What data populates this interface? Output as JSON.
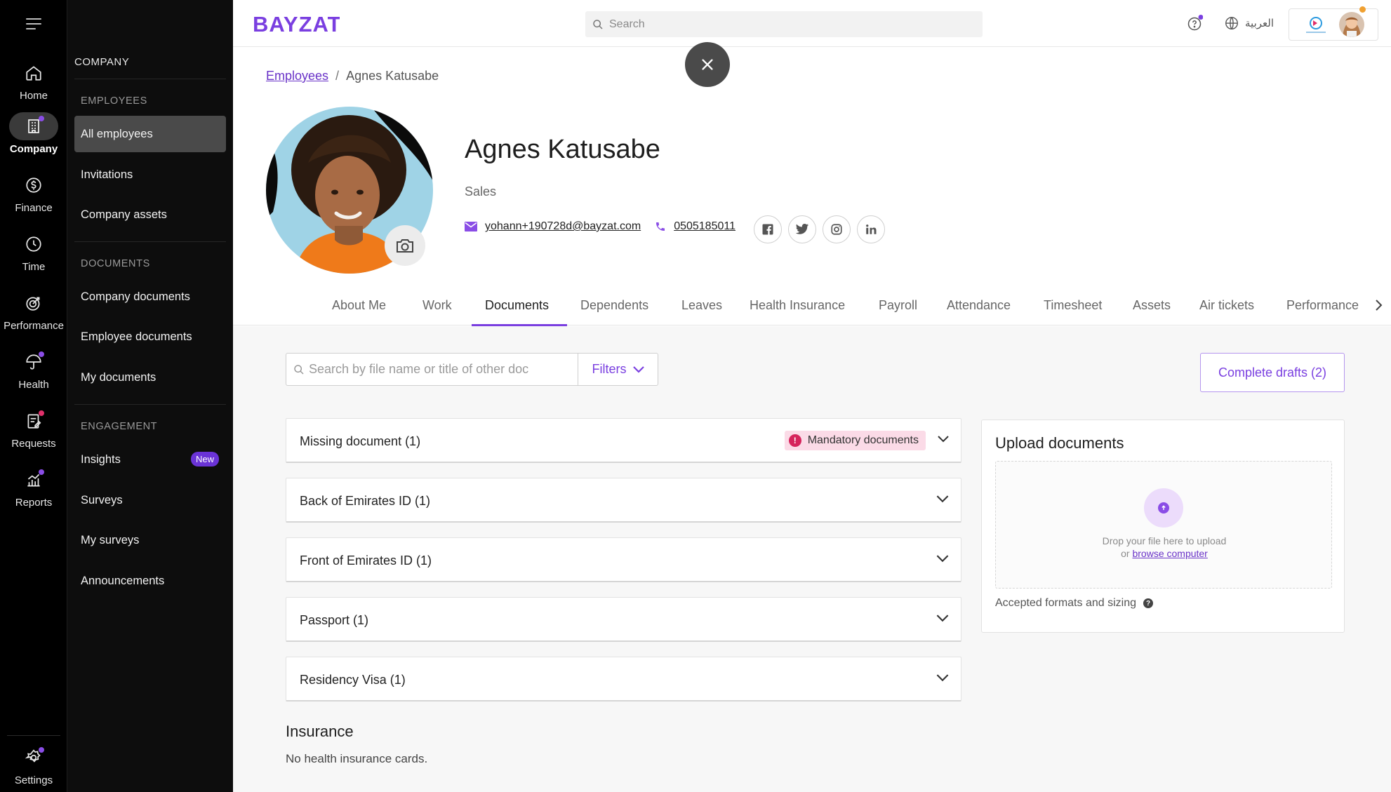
{
  "rail": {
    "items": [
      {
        "label": "Home"
      },
      {
        "label": "Company"
      },
      {
        "label": "Finance"
      },
      {
        "label": "Time"
      },
      {
        "label": "Performance"
      },
      {
        "label": "Health"
      },
      {
        "label": "Requests"
      },
      {
        "label": "Reports"
      }
    ],
    "settings": {
      "label": "Settings"
    }
  },
  "subnav": {
    "title": "COMPANY",
    "sections": [
      {
        "heading": "EMPLOYEES",
        "items": [
          "All employees",
          "Invitations",
          "Company assets"
        ]
      },
      {
        "heading": "DOCUMENTS",
        "items": [
          "Company documents",
          "Employee documents",
          "My documents"
        ]
      },
      {
        "heading": "ENGAGEMENT",
        "items": [
          "Insights",
          "Surveys",
          "My surveys",
          "Announcements"
        ]
      }
    ],
    "insights_badge": "New"
  },
  "header": {
    "logo": "BAYZAT",
    "search_placeholder": "Search",
    "language": "العربية",
    "brand_color": "#7a3fe0"
  },
  "breadcrumb": {
    "parent": "Employees",
    "current": "Agnes Katusabe"
  },
  "profile": {
    "name": "Agnes Katusabe",
    "department": "Sales",
    "email": "yohann+190728d@bayzat.com",
    "phone": "0505185011"
  },
  "tabs": [
    "About Me",
    "Work",
    "Documents",
    "Dependents",
    "Leaves",
    "Health Insurance",
    "Payroll",
    "Attendance",
    "Timesheet",
    "Assets",
    "Air tickets",
    "Performance"
  ],
  "active_tab": "Documents",
  "documents": {
    "search_placeholder": "Search by file name or title of other doc",
    "filters_label": "Filters",
    "drafts_label": "Complete drafts (2)",
    "sections": [
      {
        "title": "Missing document (1)",
        "tag": "Mandatory documents"
      },
      {
        "title": "Back of Emirates ID (1)"
      },
      {
        "title": "Front of Emirates ID (1)"
      },
      {
        "title": "Passport (1)"
      },
      {
        "title": "Residency Visa (1)"
      }
    ],
    "insurance_title": "Insurance",
    "insurance_empty": "No health insurance cards."
  },
  "upload": {
    "title": "Upload documents",
    "drop_text": "Drop your file here to upload",
    "or_text": "or",
    "browse_text": "browse computer",
    "accepted_text": "Accepted formats and sizing"
  }
}
